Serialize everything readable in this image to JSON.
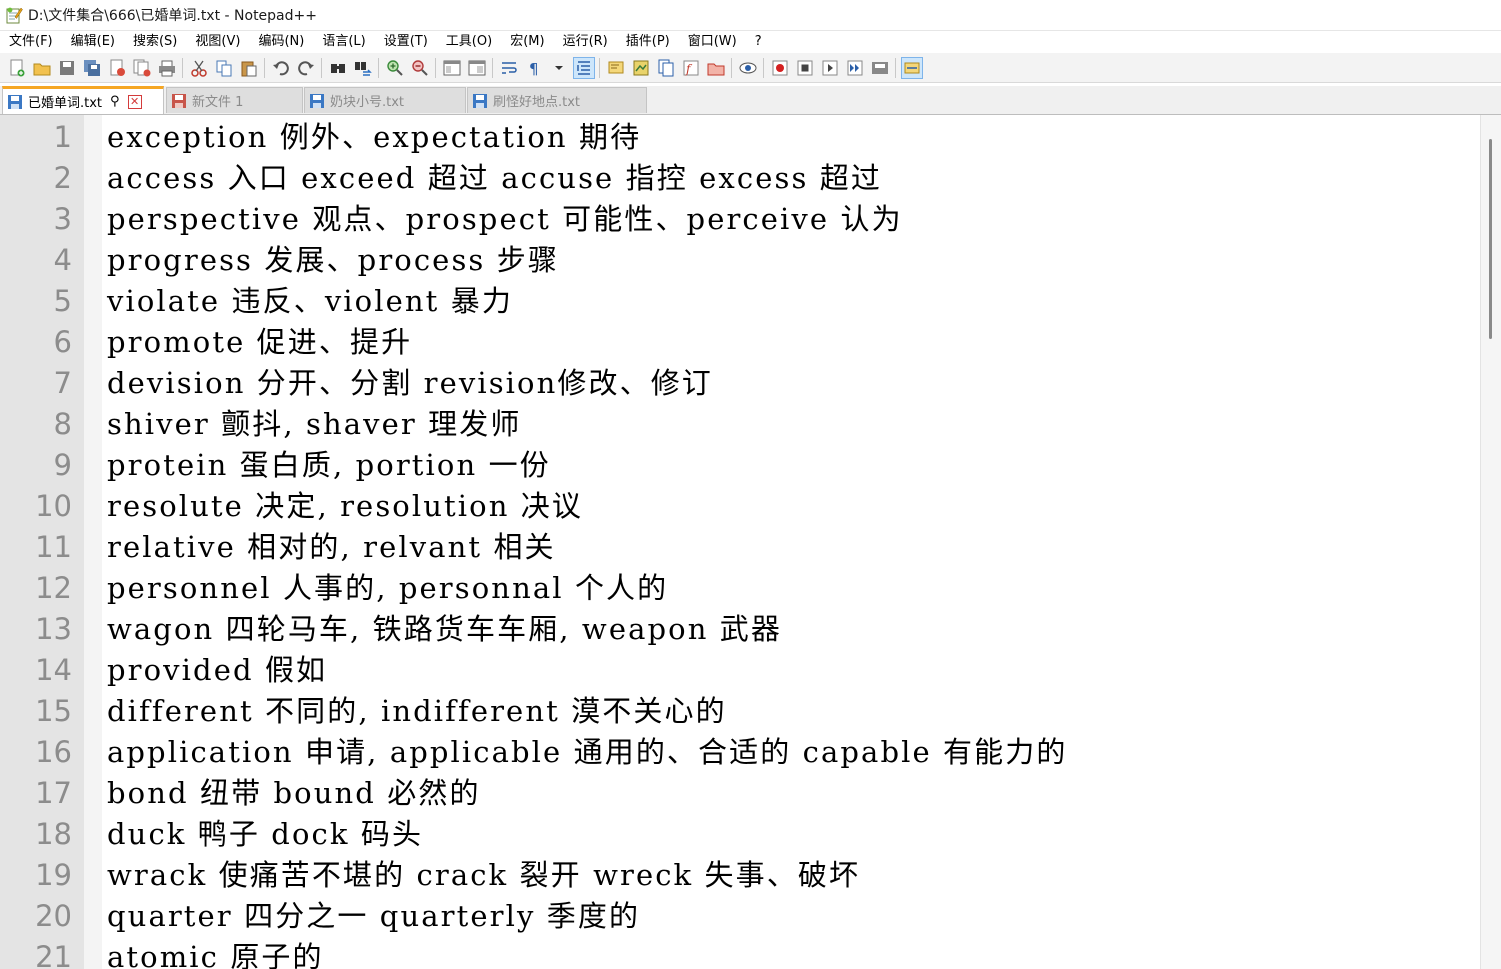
{
  "window": {
    "title": "D:\\文件集合\\666\\已婚单词.txt - Notepad++"
  },
  "menu": [
    {
      "label": "文件(F)"
    },
    {
      "label": "编辑(E)"
    },
    {
      "label": "搜索(S)"
    },
    {
      "label": "视图(V)"
    },
    {
      "label": "编码(N)"
    },
    {
      "label": "语言(L)"
    },
    {
      "label": "设置(T)"
    },
    {
      "label": "工具(O)"
    },
    {
      "label": "宏(M)"
    },
    {
      "label": "运行(R)"
    },
    {
      "label": "插件(P)"
    },
    {
      "label": "窗口(W)"
    },
    {
      "label": "?"
    }
  ],
  "toolbar": {
    "icons": [
      "new-file-icon",
      "open-file-icon",
      "save-icon",
      "save-all-icon",
      "close-icon",
      "close-all-icon",
      "print-icon",
      "cut-icon",
      "copy-icon",
      "paste-icon",
      "undo-icon",
      "redo-icon",
      "find-icon",
      "replace-icon",
      "zoom-in-icon",
      "zoom-out-icon",
      "sync-vertical-icon",
      "sync-horizontal-icon",
      "word-wrap-icon",
      "show-all-chars-icon",
      "indent-guide-icon",
      "udl-icon",
      "doc-map-icon",
      "doc-list-icon",
      "function-list-icon",
      "folder-workspace-icon",
      "monitoring-icon",
      "record-macro-icon",
      "stop-macro-icon",
      "play-macro-icon",
      "run-macro-multiple-icon",
      "save-macro-icon",
      "spell-check-icon"
    ]
  },
  "tabs": [
    {
      "label": "已婚单词.txt",
      "active": true,
      "pin": "⚲",
      "close": "✕"
    },
    {
      "label": "新文件 1",
      "active": false
    },
    {
      "label": "奶块小号.txt",
      "active": false
    },
    {
      "label": "刷怪好地点.txt",
      "active": false
    }
  ],
  "editor": {
    "lines": [
      {
        "num": "1",
        "text": "exception 例外、expectation 期待"
      },
      {
        "num": "2",
        "text": "access 入口 exceed 超过 accuse 指控 excess 超过"
      },
      {
        "num": "3",
        "text": "perspective 观点、prospect 可能性、perceive 认为"
      },
      {
        "num": "4",
        "text": "progress 发展、process 步骤"
      },
      {
        "num": "5",
        "text": "violate 违反、violent 暴力"
      },
      {
        "num": "6",
        "text": "promote 促进、提升"
      },
      {
        "num": "7",
        "text": "devision 分开、分割 revision修改、修订"
      },
      {
        "num": "8",
        "text": "shiver 颤抖, shaver 理发师"
      },
      {
        "num": "9",
        "text": "protein 蛋白质, portion 一份"
      },
      {
        "num": "10",
        "text": "resolute 决定, resolution 决议"
      },
      {
        "num": "11",
        "text": "relative 相对的, relvant 相关"
      },
      {
        "num": "12",
        "text": "personnel 人事的, personnal 个人的"
      },
      {
        "num": "13",
        "text": "wagon 四轮马车, 铁路货车车厢, weapon 武器"
      },
      {
        "num": "14",
        "text": "provided 假如"
      },
      {
        "num": "15",
        "text": "different 不同的, indifferent 漠不关心的"
      },
      {
        "num": "16",
        "text": "application 申请, applicable 通用的、合适的 capable 有能力的"
      },
      {
        "num": "17",
        "text": "bond 纽带 bound 必然的"
      },
      {
        "num": "18",
        "text": "duck 鸭子 dock 码头"
      },
      {
        "num": "19",
        "text": "wrack 使痛苦不堪的 crack 裂开 wreck 失事、破坏"
      },
      {
        "num": "20",
        "text": "quarter 四分之一 quarterly 季度的"
      },
      {
        "num": "21",
        "text": "atomic 原子的"
      }
    ]
  },
  "colors": {
    "gutter": "#e4e4e4",
    "line_number": "#8c8c8c",
    "active_tab_accent": "#f5a623",
    "tab_close": "#d43b3b"
  }
}
